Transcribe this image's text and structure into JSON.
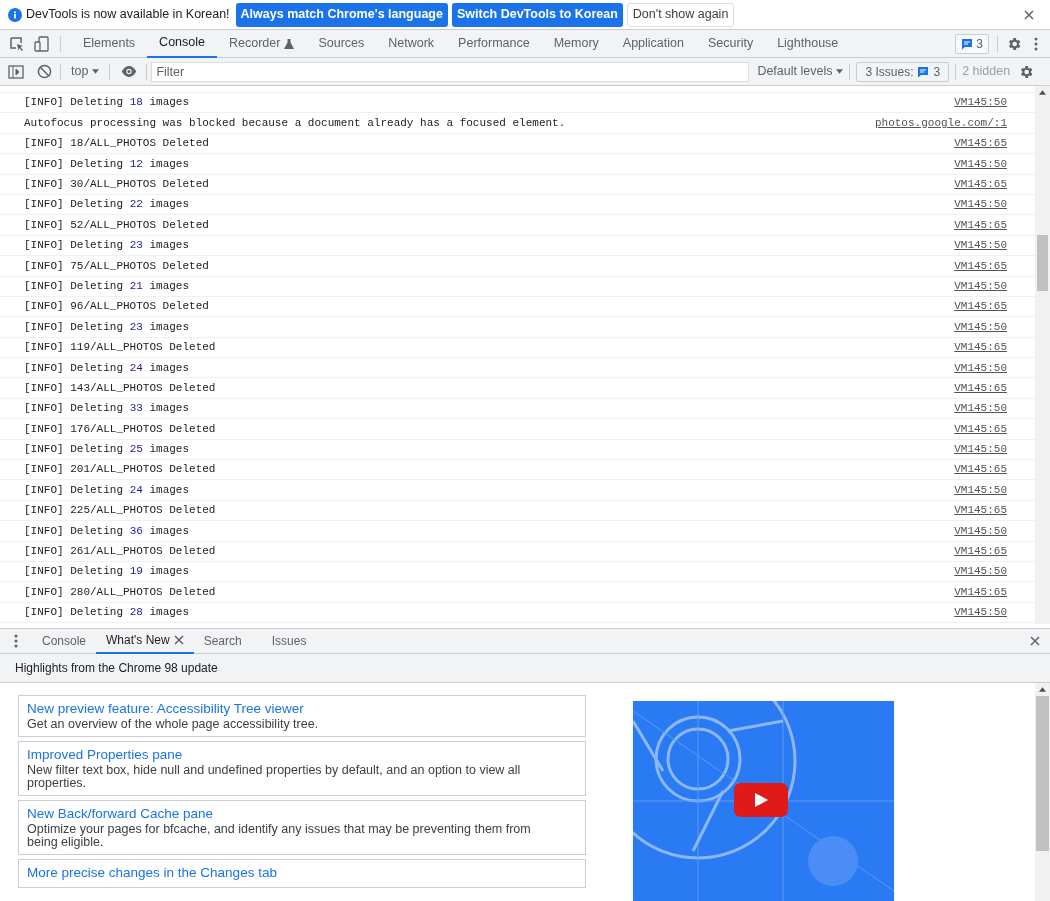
{
  "infobar": {
    "message": "DevTools is now available in Korean!",
    "buttons": [
      {
        "label": "Always match Chrome's language",
        "kind": "primary"
      },
      {
        "label": "Switch DevTools to Korean",
        "kind": "primary"
      },
      {
        "label": "Don't show again",
        "kind": "secondary"
      }
    ]
  },
  "main_tabs": [
    {
      "label": "Elements",
      "selected": false
    },
    {
      "label": "Console",
      "selected": true
    },
    {
      "label": "Recorder",
      "selected": false,
      "experimental": true
    },
    {
      "label": "Sources",
      "selected": false
    },
    {
      "label": "Network",
      "selected": false
    },
    {
      "label": "Performance",
      "selected": false
    },
    {
      "label": "Memory",
      "selected": false
    },
    {
      "label": "Application",
      "selected": false
    },
    {
      "label": "Security",
      "selected": false
    },
    {
      "label": "Lighthouse",
      "selected": false
    }
  ],
  "issues_badge": "3",
  "console_toolbar": {
    "context": "top",
    "filter_placeholder": "Filter",
    "levels": "Default levels",
    "issues_label": "3 Issues:",
    "issues_count": "3",
    "hidden": "2 hidden"
  },
  "messages": [
    {
      "parts": [
        {
          "text": "[INFO] Deleting ",
          "kind": "text"
        },
        {
          "text": "18",
          "kind": "number"
        },
        {
          "text": " images",
          "kind": "text"
        }
      ],
      "source": "VM145:50"
    },
    {
      "parts": [
        {
          "text": "Autofocus processing was blocked because a document already has a focused element.",
          "kind": "text"
        }
      ],
      "source": "photos.google.com/:1"
    },
    {
      "parts": [
        {
          "text": "[INFO] 18/ALL_PHOTOS Deleted",
          "kind": "text"
        }
      ],
      "source": "VM145:65"
    },
    {
      "parts": [
        {
          "text": "[INFO] Deleting ",
          "kind": "text"
        },
        {
          "text": "12",
          "kind": "number"
        },
        {
          "text": " images",
          "kind": "text"
        }
      ],
      "source": "VM145:50"
    },
    {
      "parts": [
        {
          "text": "[INFO] 30/ALL_PHOTOS Deleted",
          "kind": "text"
        }
      ],
      "source": "VM145:65"
    },
    {
      "parts": [
        {
          "text": "[INFO] Deleting ",
          "kind": "text"
        },
        {
          "text": "22",
          "kind": "number"
        },
        {
          "text": " images",
          "kind": "text"
        }
      ],
      "source": "VM145:50"
    },
    {
      "parts": [
        {
          "text": "[INFO] 52/ALL_PHOTOS Deleted",
          "kind": "text"
        }
      ],
      "source": "VM145:65"
    },
    {
      "parts": [
        {
          "text": "[INFO] Deleting ",
          "kind": "text"
        },
        {
          "text": "23",
          "kind": "number"
        },
        {
          "text": " images",
          "kind": "text"
        }
      ],
      "source": "VM145:50"
    },
    {
      "parts": [
        {
          "text": "[INFO] 75/ALL_PHOTOS Deleted",
          "kind": "text"
        }
      ],
      "source": "VM145:65"
    },
    {
      "parts": [
        {
          "text": "[INFO] Deleting ",
          "kind": "text"
        },
        {
          "text": "21",
          "kind": "number"
        },
        {
          "text": " images",
          "kind": "text"
        }
      ],
      "source": "VM145:50"
    },
    {
      "parts": [
        {
          "text": "[INFO] 96/ALL_PHOTOS Deleted",
          "kind": "text"
        }
      ],
      "source": "VM145:65"
    },
    {
      "parts": [
        {
          "text": "[INFO] Deleting ",
          "kind": "text"
        },
        {
          "text": "23",
          "kind": "number"
        },
        {
          "text": " images",
          "kind": "text"
        }
      ],
      "source": "VM145:50"
    },
    {
      "parts": [
        {
          "text": "[INFO] 119/ALL_PHOTOS Deleted",
          "kind": "text"
        }
      ],
      "source": "VM145:65"
    },
    {
      "parts": [
        {
          "text": "[INFO] Deleting ",
          "kind": "text"
        },
        {
          "text": "24",
          "kind": "number"
        },
        {
          "text": " images",
          "kind": "text"
        }
      ],
      "source": "VM145:50"
    },
    {
      "parts": [
        {
          "text": "[INFO] 143/ALL_PHOTOS Deleted",
          "kind": "text"
        }
      ],
      "source": "VM145:65"
    },
    {
      "parts": [
        {
          "text": "[INFO] Deleting ",
          "kind": "text"
        },
        {
          "text": "33",
          "kind": "number"
        },
        {
          "text": " images",
          "kind": "text"
        }
      ],
      "source": "VM145:50"
    },
    {
      "parts": [
        {
          "text": "[INFO] 176/ALL_PHOTOS Deleted",
          "kind": "text"
        }
      ],
      "source": "VM145:65"
    },
    {
      "parts": [
        {
          "text": "[INFO] Deleting ",
          "kind": "text"
        },
        {
          "text": "25",
          "kind": "number"
        },
        {
          "text": " images",
          "kind": "text"
        }
      ],
      "source": "VM145:50"
    },
    {
      "parts": [
        {
          "text": "[INFO] 201/ALL_PHOTOS Deleted",
          "kind": "text"
        }
      ],
      "source": "VM145:65"
    },
    {
      "parts": [
        {
          "text": "[INFO] Deleting ",
          "kind": "text"
        },
        {
          "text": "24",
          "kind": "number"
        },
        {
          "text": " images",
          "kind": "text"
        }
      ],
      "source": "VM145:50"
    },
    {
      "parts": [
        {
          "text": "[INFO] 225/ALL_PHOTOS Deleted",
          "kind": "text"
        }
      ],
      "source": "VM145:65"
    },
    {
      "parts": [
        {
          "text": "[INFO] Deleting ",
          "kind": "text"
        },
        {
          "text": "36",
          "kind": "number"
        },
        {
          "text": " images",
          "kind": "text"
        }
      ],
      "source": "VM145:50"
    },
    {
      "parts": [
        {
          "text": "[INFO] 261/ALL_PHOTOS Deleted",
          "kind": "text"
        }
      ],
      "source": "VM145:65"
    },
    {
      "parts": [
        {
          "text": "[INFO] Deleting ",
          "kind": "text"
        },
        {
          "text": "19",
          "kind": "number"
        },
        {
          "text": " images",
          "kind": "text"
        }
      ],
      "source": "VM145:50"
    },
    {
      "parts": [
        {
          "text": "[INFO] 280/ALL_PHOTOS Deleted",
          "kind": "text"
        }
      ],
      "source": "VM145:65"
    },
    {
      "parts": [
        {
          "text": "[INFO] Deleting ",
          "kind": "text"
        },
        {
          "text": "28",
          "kind": "number"
        },
        {
          "text": " images",
          "kind": "text"
        }
      ],
      "source": "VM145:50"
    }
  ],
  "drawer_tabs": [
    {
      "label": "Console",
      "selected": false,
      "closable": false
    },
    {
      "label": "What's New",
      "selected": true,
      "closable": true
    },
    {
      "label": "Search",
      "selected": false,
      "closable": false
    },
    {
      "label": "Issues",
      "selected": false,
      "closable": false
    }
  ],
  "whats_new": {
    "heading": "Highlights from the Chrome 98 update",
    "cards": [
      {
        "title": "New preview feature: Accessibility Tree viewer",
        "description": "Get an overview of the whole page accessibility tree."
      },
      {
        "title": "Improved Properties pane",
        "description": "New filter text box, hide null and undefined properties by default, and an option to view all properties."
      },
      {
        "title": "New Back/forward Cache pane",
        "description": "Optimize your pages for bfcache, and identify any issues that may be preventing them from being eligible."
      },
      {
        "title": "More precise changes in the Changes tab"
      }
    ]
  }
}
